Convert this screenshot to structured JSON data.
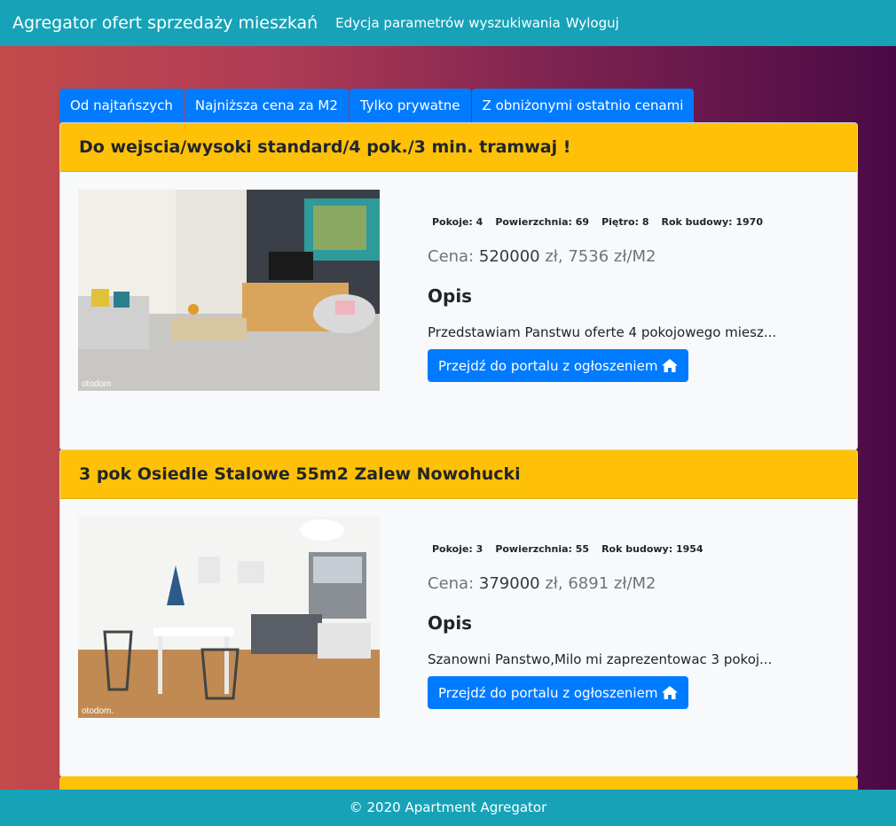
{
  "navbar": {
    "brand": "Agregator ofert sprzedaży mieszkań",
    "links": [
      "Edycja parametrów wyszukiwania",
      "Wyloguj"
    ]
  },
  "tabs": [
    "Od najtańszych",
    "Najniższa cena za M2",
    "Tylko prywatne",
    "Z obniżonymi ostatnio cenami"
  ],
  "listings": [
    {
      "title": "Do wejscia/wysoki standard/4 pok./3 min. tramwaj !",
      "params": [
        "Pokoje: 4",
        "Powierzchnia: 69",
        "Piętro: 8",
        "Rok budowy: 1970"
      ],
      "price_label": "Cena:",
      "price": "520000",
      "price_rest": "zł, 7536 zł/M2",
      "opis_label": "Opis",
      "description": "Przedstawiam Panstwu oferte 4 pokojowego miesz...",
      "button": "Przejdź do portalu z ogłoszeniem",
      "watermark": "otodom"
    },
    {
      "title": "3 pok Osiedle Stalowe 55m2 Zalew Nowohucki",
      "params": [
        "Pokoje: 3",
        "Powierzchnia: 55",
        "Rok budowy: 1954"
      ],
      "price_label": "Cena:",
      "price": "379000",
      "price_rest": "zł, 6891 zł/M2",
      "opis_label": "Opis",
      "description": "Szanowni Panstwo,Milo mi zaprezentowac 3 pokoj...",
      "button": "Przejdź do portalu z ogłoszeniem",
      "watermark": "otodom."
    }
  ],
  "footer": "© 2020 Apartment Agregator"
}
